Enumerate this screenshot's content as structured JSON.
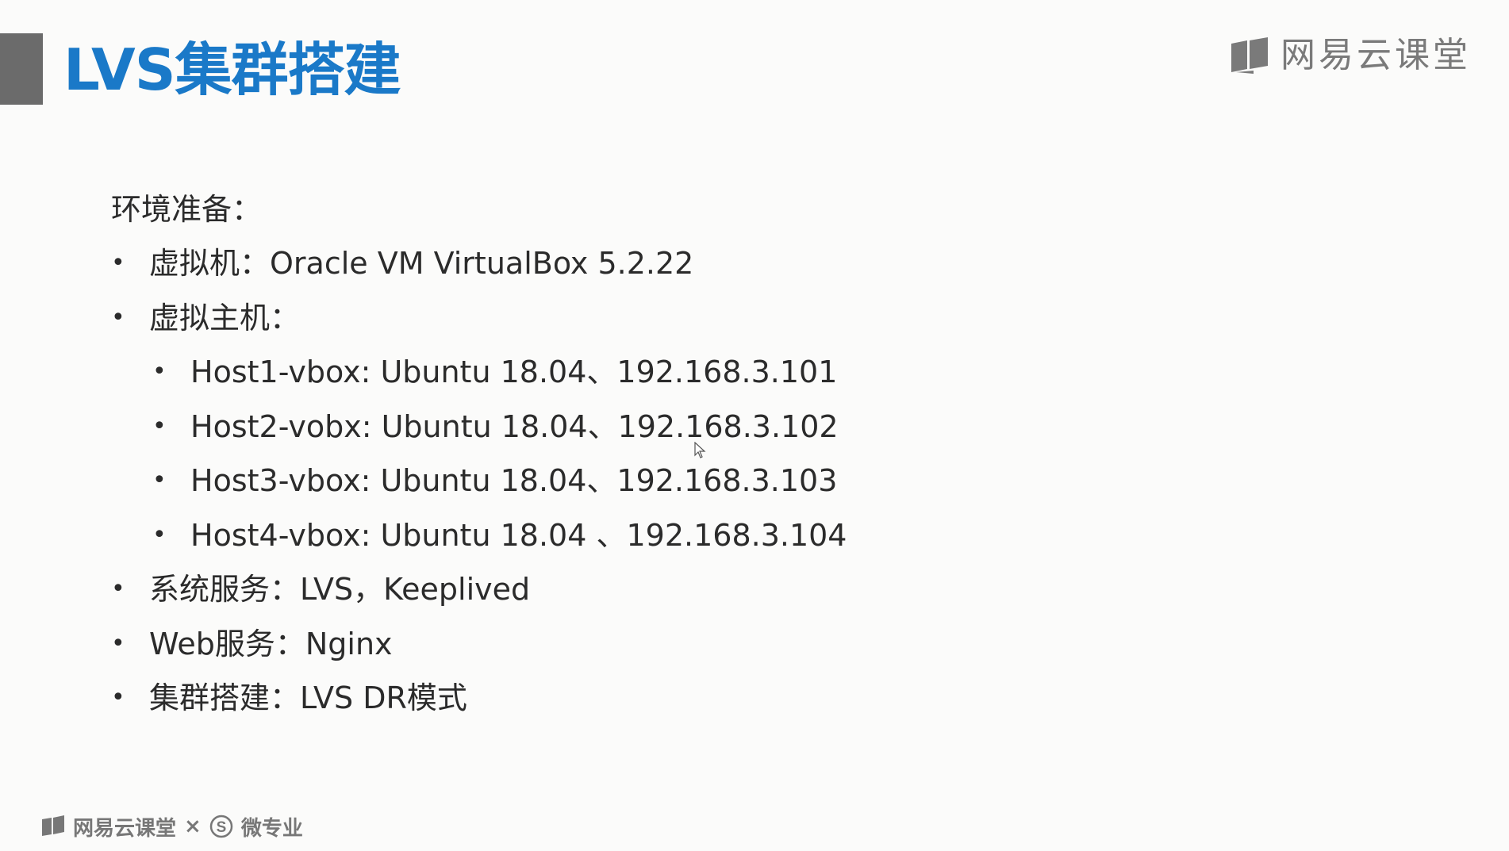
{
  "slide": {
    "title": "LVS集群搭建"
  },
  "brand": {
    "name": "网易云课堂"
  },
  "content": {
    "heading": "环境准备：",
    "items": [
      {
        "label": "虚拟机：Oracle VM VirtualBox 5.2.22",
        "level": 1
      },
      {
        "label": "虚拟主机：",
        "level": 1
      },
      {
        "label": "Host1-vbox: Ubuntu 18.04、192.168.3.101",
        "level": 2
      },
      {
        "label": "Host2-vobx: Ubuntu 18.04、192.168.3.102",
        "level": 2
      },
      {
        "label": "Host3-vbox: Ubuntu 18.04、192.168.3.103",
        "level": 2
      },
      {
        "label": "Host4-vbox: Ubuntu 18.04 、192.168.3.104",
        "level": 2
      },
      {
        "label": "系统服务：LVS，Keeplived",
        "level": 1
      },
      {
        "label": "Web服务：Nginx",
        "level": 1
      },
      {
        "label": "集群搭建：LVS DR模式",
        "level": 1
      }
    ],
    "bullet": "•"
  },
  "footer": {
    "brand": "网易云课堂",
    "separator": "×",
    "partner": "微专业"
  },
  "colors": {
    "title": "#1a79c8",
    "accent_bar": "#6b6b6b",
    "text": "#2b2b2b",
    "brand": "#7a7a7a"
  },
  "icons": {
    "brand": "book-icon",
    "partner": "s-circle-icon",
    "cursor": "mouse-pointer-icon"
  }
}
